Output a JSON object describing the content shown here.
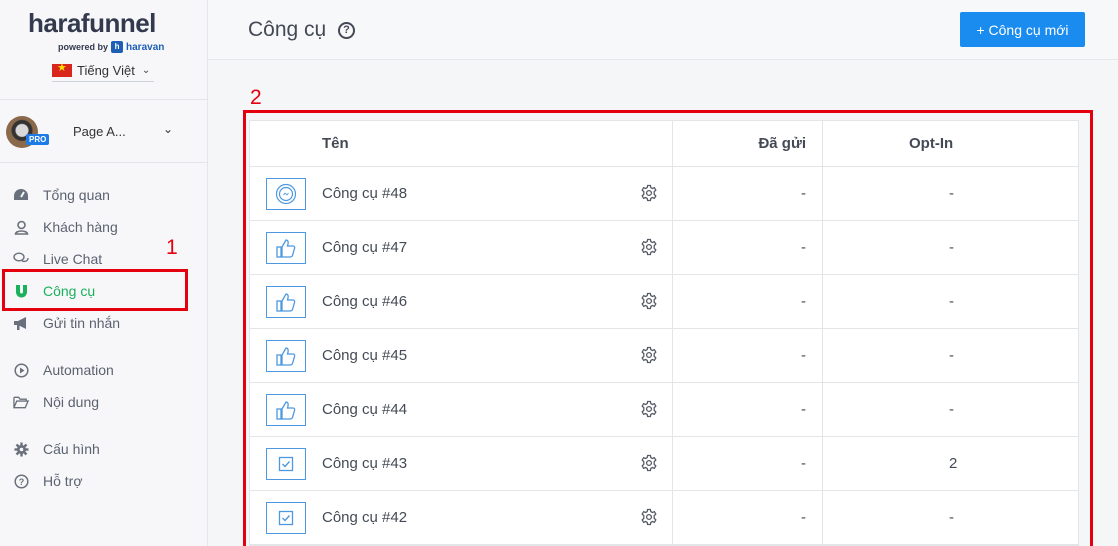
{
  "brand": {
    "name": "harafunnel",
    "powered_by": "powered by",
    "partner": "haravan"
  },
  "language": {
    "label": "Tiếng Việt"
  },
  "page": {
    "name": "Page A...",
    "badge": "PRO"
  },
  "nav": [
    {
      "label": "Tổng quan",
      "icon": "dashboard-icon"
    },
    {
      "label": "Khách hàng",
      "icon": "user-icon"
    },
    {
      "label": "Live Chat",
      "icon": "chat-icon"
    },
    {
      "label": "Công cụ",
      "icon": "magnet-icon",
      "active": true
    },
    {
      "label": "Gửi tin nhắn",
      "icon": "megaphone-icon"
    },
    {
      "label": "Automation",
      "icon": "play-circle-icon"
    },
    {
      "label": "Nội dung",
      "icon": "folder-icon"
    },
    {
      "label": "Cấu hình",
      "icon": "gear-icon"
    },
    {
      "label": "Hỗ trợ",
      "icon": "help-icon"
    }
  ],
  "header": {
    "title": "Công cụ",
    "new_button": "+ Công cụ mới"
  },
  "annotations": {
    "mark1": "1",
    "mark2": "2"
  },
  "colors": {
    "accent": "#1a8cf0",
    "active": "#1bb05c",
    "highlight": "#e4000f"
  },
  "table": {
    "columns": {
      "name": "Tên",
      "sent": "Đã gửi",
      "optin": "Opt-In"
    },
    "rows": [
      {
        "icon": "messenger-icon",
        "name": "Công cụ #48",
        "sent": "-",
        "optin": "-"
      },
      {
        "icon": "like-icon",
        "name": "Công cụ #47",
        "sent": "-",
        "optin": "-"
      },
      {
        "icon": "like-icon",
        "name": "Công cụ #46",
        "sent": "-",
        "optin": "-"
      },
      {
        "icon": "like-icon",
        "name": "Công cụ #45",
        "sent": "-",
        "optin": "-"
      },
      {
        "icon": "like-icon",
        "name": "Công cụ #44",
        "sent": "-",
        "optin": "-"
      },
      {
        "icon": "checkbox-icon",
        "name": "Công cụ #43",
        "sent": "-",
        "optin": "2"
      },
      {
        "icon": "checkbox-icon",
        "name": "Công cụ #42",
        "sent": "-",
        "optin": "-"
      }
    ]
  }
}
